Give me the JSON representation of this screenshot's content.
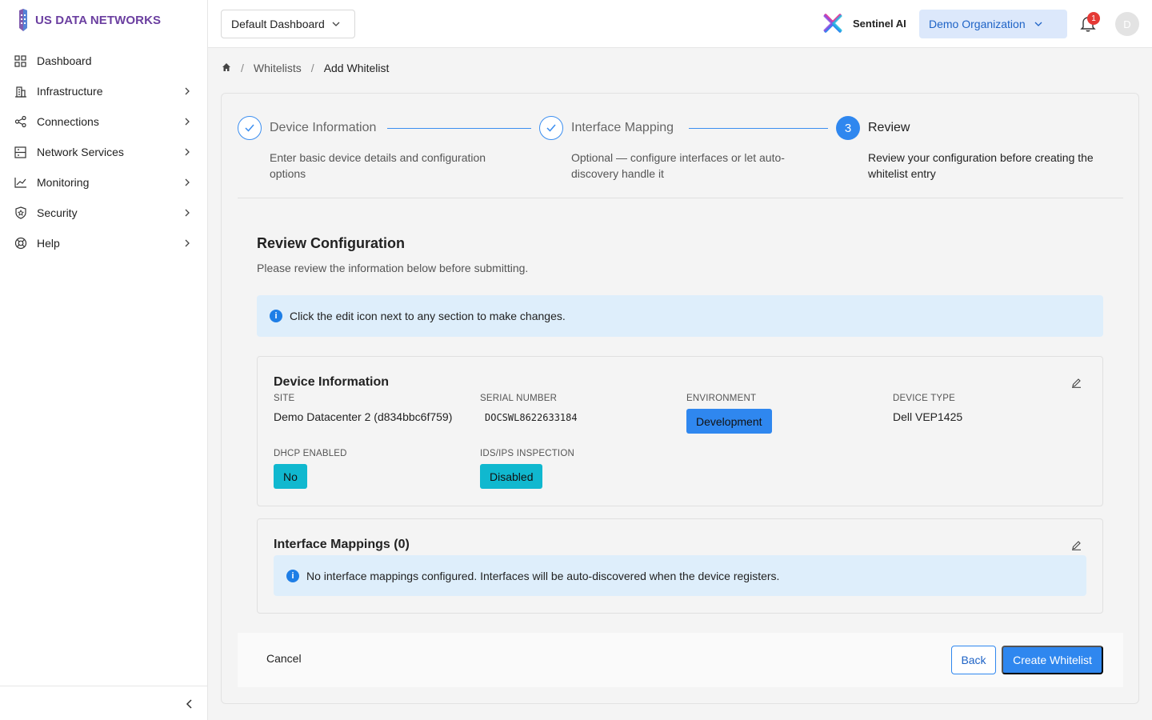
{
  "brand": {
    "name": "US DATA NETWORKS"
  },
  "sidebar": {
    "items": [
      {
        "label": "Dashboard",
        "icon": "grid-icon"
      },
      {
        "label": "Infrastructure",
        "icon": "building-icon"
      },
      {
        "label": "Connections",
        "icon": "share-icon"
      },
      {
        "label": "Network Services",
        "icon": "server-icon"
      },
      {
        "label": "Monitoring",
        "icon": "chart-line-icon"
      },
      {
        "label": "Security",
        "icon": "shield-icon"
      },
      {
        "label": "Help",
        "icon": "lifebuoy-icon"
      }
    ]
  },
  "topbar": {
    "dashboard_select": "Default Dashboard",
    "sentinel_label": "Sentinel AI",
    "org_select": "Demo Organization",
    "notification_count": "1",
    "avatar_initial": "D"
  },
  "breadcrumb": {
    "items": [
      "Whitelists",
      "Add Whitelist"
    ]
  },
  "stepper": {
    "steps": [
      {
        "number": "1",
        "title": "Device Information",
        "desc": "Enter basic device details and configuration options",
        "state": "done"
      },
      {
        "number": "2",
        "title": "Interface Mapping",
        "desc": "Optional — configure interfaces or let auto-discovery handle it",
        "state": "done"
      },
      {
        "number": "3",
        "title": "Review",
        "desc": "Review your configuration before creating the whitelist entry",
        "state": "active"
      }
    ]
  },
  "review": {
    "title": "Review Configuration",
    "subtitle": "Please review the information below before submitting.",
    "info": "Click the edit icon next to any section to make changes."
  },
  "device_info": {
    "title": "Device Information",
    "site_label": "SITE",
    "site_value": "Demo Datacenter 2 (d834bbc6f759)",
    "serial_label": "SERIAL NUMBER",
    "serial_value": "DOCSWL8622633184",
    "env_label": "ENVIRONMENT",
    "env_value": "Development",
    "type_label": "DEVICE TYPE",
    "type_value": "Dell VEP1425",
    "dhcp_label": "DHCP ENABLED",
    "dhcp_value": "No",
    "ids_label": "IDS/IPS INSPECTION",
    "ids_value": "Disabled"
  },
  "interface_mappings": {
    "title": "Interface Mappings (0)",
    "info": "No interface mappings configured. Interfaces will be auto-discovered when the device registers."
  },
  "footer": {
    "cancel": "Cancel",
    "back": "Back",
    "create": "Create Whitelist"
  },
  "colors": {
    "primary": "#2f87ef",
    "brand": "#6b3fa0",
    "env_chip": "#2f87ef",
    "status_chip": "#10b8cf",
    "info_bg": "#deeefb",
    "badge": "#e53935"
  }
}
